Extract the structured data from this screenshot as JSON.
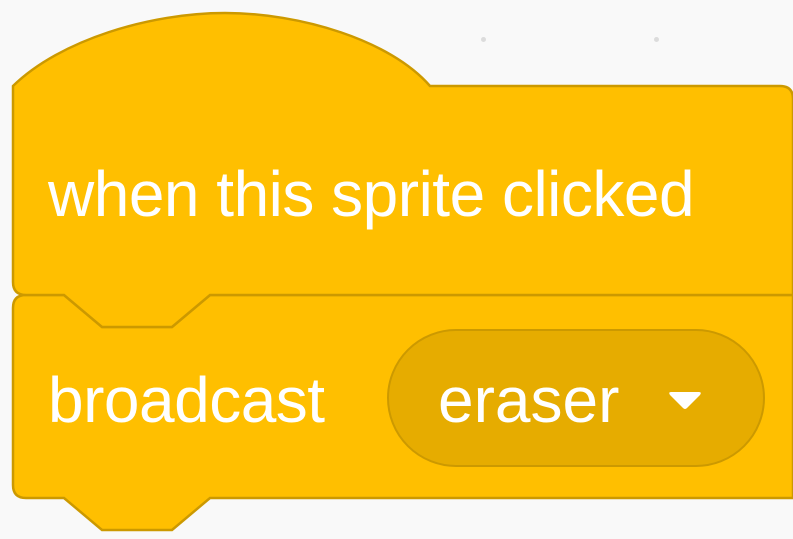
{
  "colors": {
    "block_fill": "#ffbf00",
    "block_stroke": "#cc9900",
    "dropdown_fill": "#e6ac00",
    "text": "#ffffff",
    "background": "#f9f9f9"
  },
  "hat_block": {
    "label": "when this sprite clicked"
  },
  "broadcast_block": {
    "label": "broadcast",
    "message_dropdown": {
      "selected_value": "eraser",
      "icon": "triangle-down-icon"
    }
  }
}
